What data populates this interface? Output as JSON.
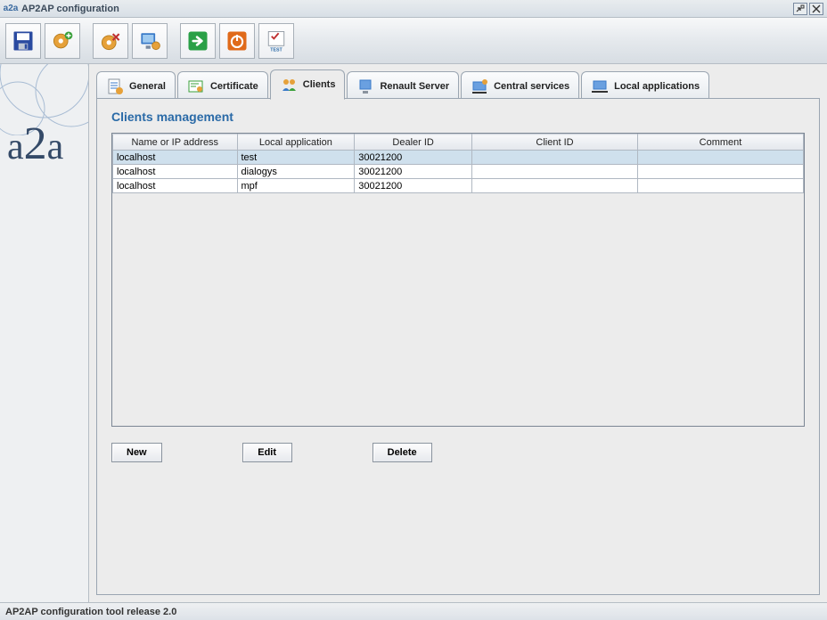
{
  "window": {
    "title": "AP2AP configuration"
  },
  "toolbar": {
    "buttons": [
      {
        "name": "save",
        "icon": "save"
      },
      {
        "name": "add",
        "icon": "gear-add"
      },
      {
        "name": "remove",
        "icon": "gear-remove"
      },
      {
        "name": "manage",
        "icon": "screen"
      },
      {
        "name": "apply",
        "icon": "arrow-right"
      },
      {
        "name": "stop",
        "icon": "power"
      },
      {
        "name": "test",
        "icon": "test"
      }
    ]
  },
  "sidebar": {
    "logo_text": "a2a"
  },
  "tabs": [
    {
      "id": "general",
      "label": "General",
      "icon": "doc"
    },
    {
      "id": "certificate",
      "label": "Certificate",
      "icon": "cert"
    },
    {
      "id": "clients",
      "label": "Clients",
      "icon": "people",
      "active": true
    },
    {
      "id": "renault",
      "label": "Renault Server",
      "icon": "server"
    },
    {
      "id": "central",
      "label": "Central services",
      "icon": "central"
    },
    {
      "id": "local",
      "label": "Local applications",
      "icon": "laptop"
    }
  ],
  "panel": {
    "title": "Clients management",
    "columns": [
      "Name or IP address",
      "Local application",
      "Dealer ID",
      "Client ID",
      "Comment"
    ],
    "rows": [
      {
        "name": "localhost",
        "app": "test",
        "dealer": "30021200",
        "client": "",
        "comment": "",
        "selected": true
      },
      {
        "name": "localhost",
        "app": "dialogys",
        "dealer": "30021200",
        "client": "",
        "comment": ""
      },
      {
        "name": "localhost",
        "app": "mpf",
        "dealer": "30021200",
        "client": "",
        "comment": ""
      }
    ],
    "buttons": {
      "new": "New",
      "edit": "Edit",
      "delete": "Delete"
    }
  },
  "status": {
    "text": "AP2AP configuration tool release 2.0"
  }
}
